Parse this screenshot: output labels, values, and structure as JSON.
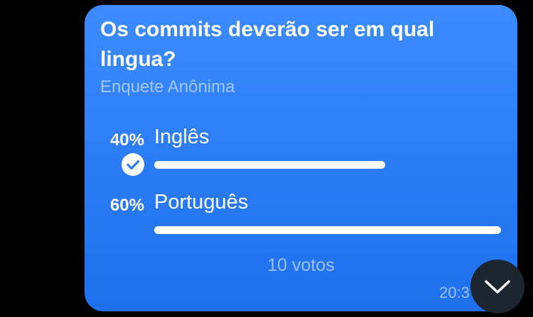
{
  "poll": {
    "question": "Os commits deverão ser em qual lingua?",
    "type_label": "Enquete Anônima",
    "options": [
      {
        "percent_label": "40%",
        "label": "Inglês",
        "fraction": 0.4,
        "selected": true
      },
      {
        "percent_label": "60%",
        "label": "Português",
        "fraction": 0.6,
        "selected": false
      }
    ],
    "votes_label": "10 votos",
    "time": "20:3"
  },
  "icons": {
    "checkmark": "check-icon",
    "scroll_down": "chevron-down-icon"
  },
  "colors": {
    "bubble": "#2a7bf4",
    "text": "#ffffff",
    "scroll_button": "#1c2630"
  }
}
